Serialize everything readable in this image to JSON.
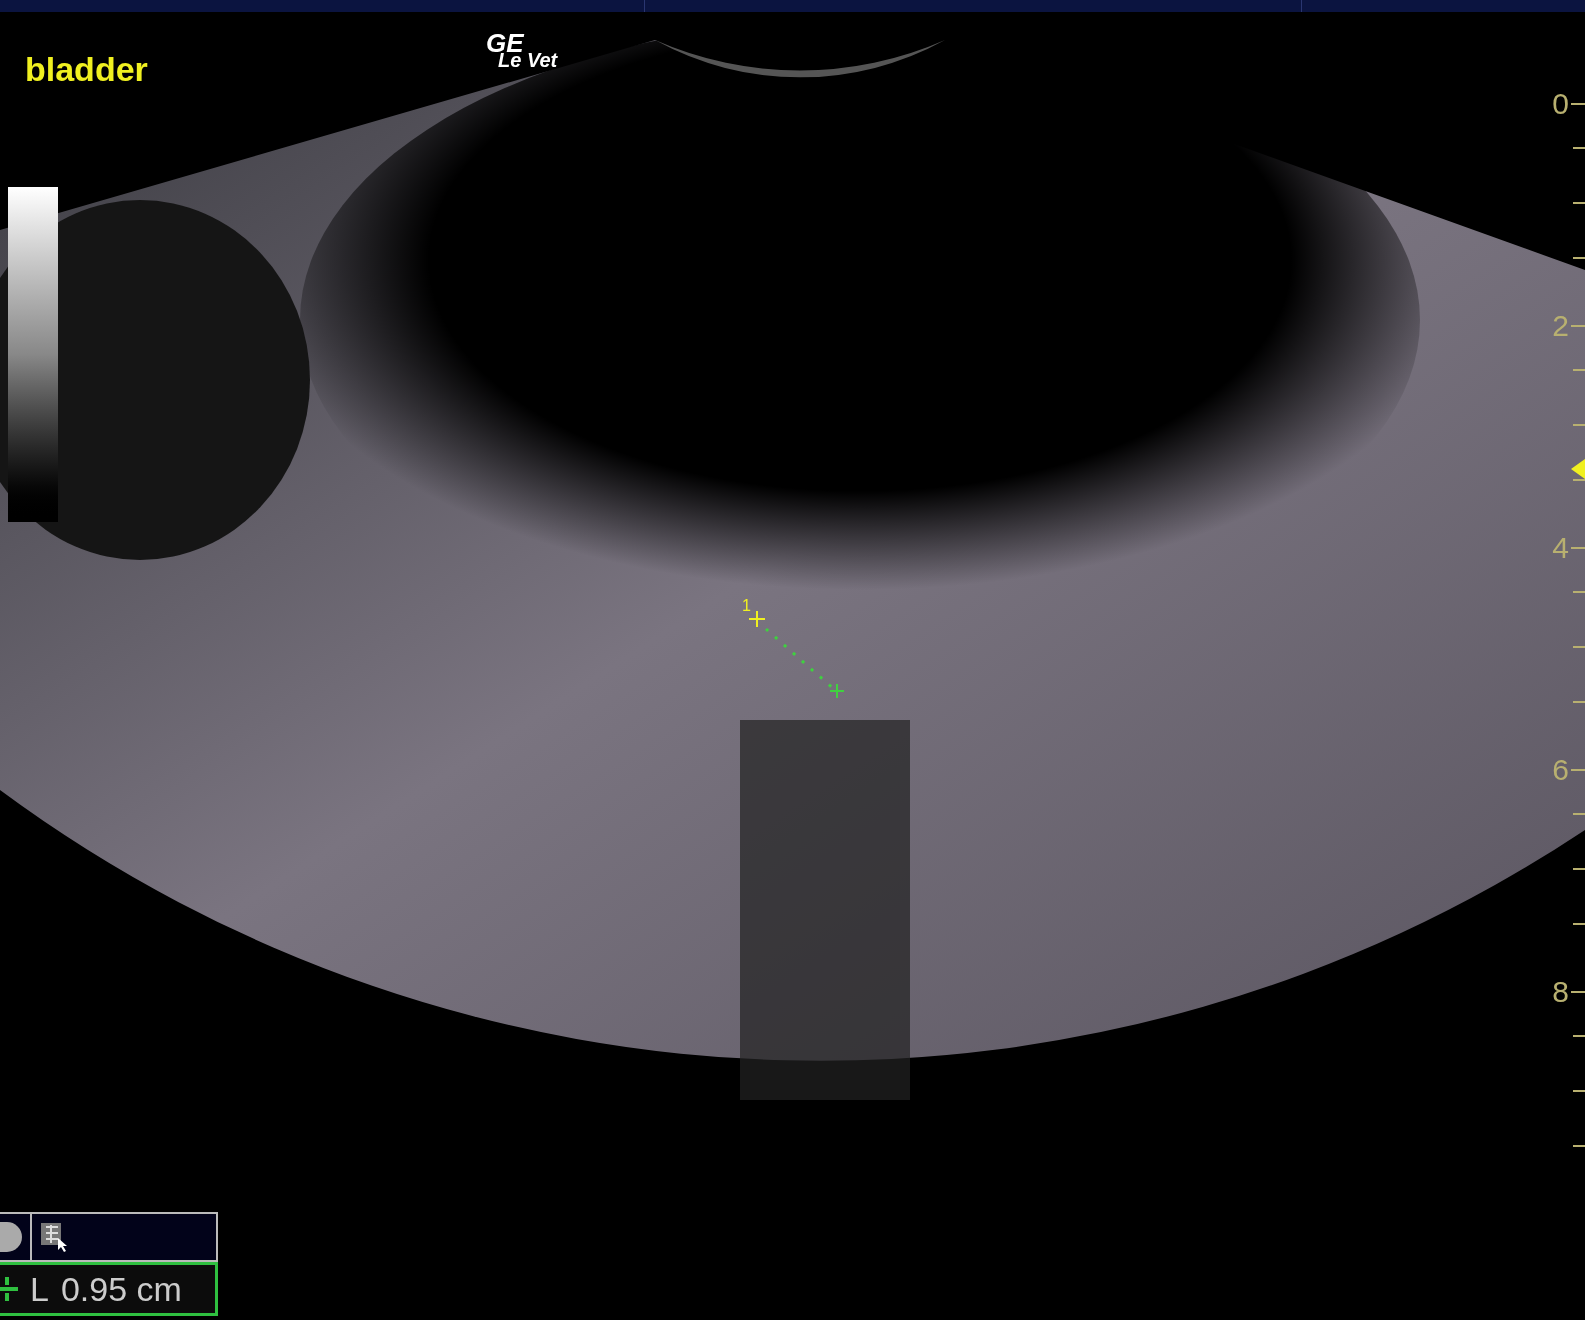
{
  "image_label": "bladder",
  "logo": {
    "line_1": "GE",
    "line_2": "Le Vet"
  },
  "depth_scale": {
    "labels": [
      "0",
      "2",
      "4",
      "6",
      "8"
    ]
  },
  "caliper": {
    "number": "1"
  },
  "measurement": {
    "label": "L",
    "value": "0.95 cm"
  }
}
